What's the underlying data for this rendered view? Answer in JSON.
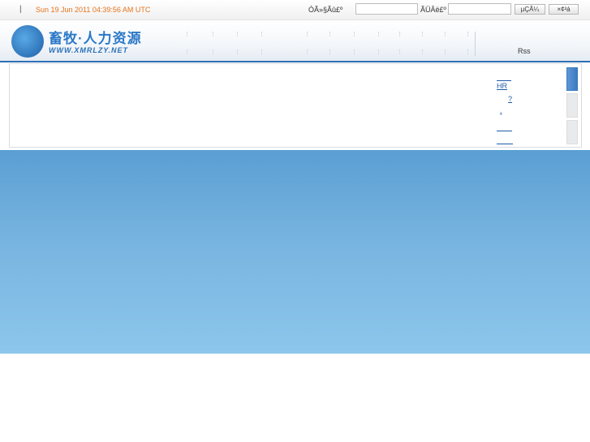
{
  "topbar": {
    "separator": "|",
    "datetime": "Sun 19 Jun 2011 04:39:56 AM UTC",
    "username_label": "ÓÃ»§Ãû£º",
    "username_value": "",
    "password_label": "ÃÜÂë£º",
    "password_value": "",
    "login_button": "µÇÂ¼",
    "register_button": "×¢²á"
  },
  "header": {
    "logo_title": "畜牧·人力资源",
    "logo_url": "WWW.XMRLZY.NET",
    "rss_label": "Rss"
  },
  "panel": {
    "links": [
      "",
      "HR",
      "?",
      ".",
      "",
      ""
    ]
  },
  "colors": {
    "accent": "#2d6fb5",
    "time_text": "#e8731a",
    "link": "#1e5ba8",
    "banner_top": "#5a9fd3",
    "banner_bottom": "#8cc6ec"
  }
}
